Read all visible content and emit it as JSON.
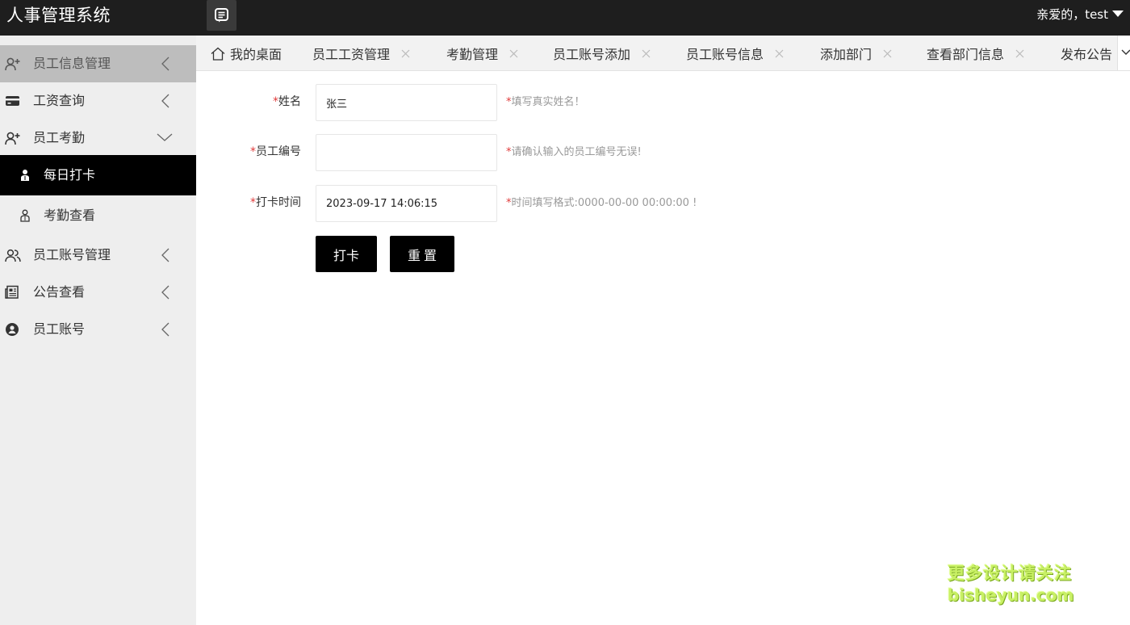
{
  "header": {
    "app_title": "人事管理系统",
    "user_greeting": "亲爱的，test",
    "menu_icon": "list-icon"
  },
  "sidebar": {
    "items": [
      {
        "label": "员工信息管理",
        "icon": "user-plus-icon",
        "arrow": "chevron-left"
      },
      {
        "label": "工资查询",
        "icon": "credit-card-icon",
        "arrow": "chevron-left"
      },
      {
        "label": "员工考勤",
        "icon": "user-plus-icon",
        "arrow": "chevron-down"
      },
      {
        "label": "员工账号管理",
        "icon": "users-icon",
        "arrow": "chevron-left"
      },
      {
        "label": "公告查看",
        "icon": "newspaper-icon",
        "arrow": "chevron-left"
      },
      {
        "label": "员工账号",
        "icon": "user-circle-icon",
        "arrow": "chevron-left"
      }
    ],
    "sub_items": [
      {
        "label": "每日打卡",
        "icon": "person-icon",
        "active": true
      },
      {
        "label": "考勤查看",
        "icon": "person-icon",
        "active": false
      }
    ]
  },
  "tabs": [
    {
      "label": "我的桌面",
      "closable": false
    },
    {
      "label": "员工工资管理",
      "closable": true
    },
    {
      "label": "考勤管理",
      "closable": true
    },
    {
      "label": "员工账号添加",
      "closable": true
    },
    {
      "label": "员工账号信息",
      "closable": true
    },
    {
      "label": "添加部门",
      "closable": true
    },
    {
      "label": "查看部门信息",
      "closable": true
    },
    {
      "label": "发布公告",
      "closable": false
    }
  ],
  "form": {
    "required_mark": "*",
    "name": {
      "label": "姓名",
      "value": "张三",
      "hint": "填写真实姓名！"
    },
    "employee_id": {
      "label": "员工编号",
      "value": "",
      "hint": "请确认输入的员工编号无误!"
    },
    "clock_time": {
      "label": "打卡时间",
      "value": "2023-09-17 14:06:15",
      "hint": "时间填写格式:0000-00-00 00:00:00 !"
    },
    "submit_label": "打卡",
    "reset_label": "重置"
  },
  "watermark": {
    "line1": "更多设计请关注",
    "line2": "bisheyun.com"
  },
  "colors": {
    "header_bg": "#1e1e1e",
    "sidebar_bg": "#eeeeee",
    "sidebar_hover": "#bdbdbd",
    "active_bg": "#000000",
    "required": "#e03a3a",
    "hint": "#999999"
  }
}
